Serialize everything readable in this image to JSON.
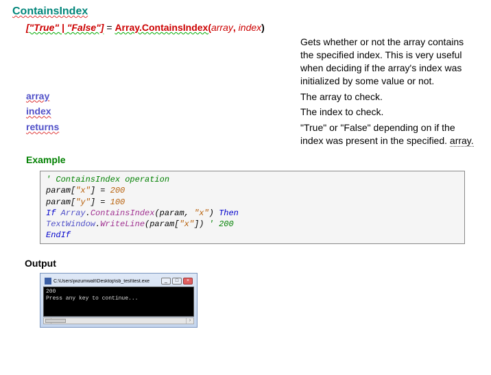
{
  "title": "ContainsIndex",
  "signature": {
    "return_spec": "[\"True\" | \"False\"]",
    "equals": " =  ",
    "class_method": "Array.ContainsIndex(",
    "arg1": "array",
    "sep": ",  ",
    "arg2": "index",
    "close": ")"
  },
  "description": "Gets whether or not the array contains the specified index. This is very useful when deciding if the array's index was initialized by some value or not.",
  "params": [
    {
      "name": "array",
      "desc": "The array to check."
    },
    {
      "name": "index",
      "desc": "The index to check."
    },
    {
      "name": "returns",
      "desc": "\"True\" or \"False\" depending on if the index was present in the specified. ",
      "desc_tail": "array."
    }
  ],
  "example_label": "Example",
  "code": {
    "l1": "' ContainsIndex operation",
    "l2a": "param[",
    "l2b": "\"x\"",
    "l2c": "] = ",
    "l2d": "200",
    "l3a": "param[",
    "l3b": "\"y\"",
    "l3c": "] = ",
    "l3d": "100",
    "l4a": "If ",
    "l4b": "Array",
    "l4c": ".",
    "l4d": "ContainsIndex",
    "l4e": "(param, ",
    "l4f": "\"x\"",
    "l4g": ") ",
    "l4h": "Then",
    "l5a": " TextWindow",
    "l5b": ".",
    "l5c": "WriteLine",
    "l5d": "(param[",
    "l5e": "\"x\"",
    "l5f": "]) ",
    "l5g": "' 200",
    "l6": "EndIf"
  },
  "output_label": "Output",
  "console": {
    "title_path": "C:\\Users\\jwzumwalt\\Desktop\\sb_test\\test.exe",
    "line1": "200",
    "line2": "Press any key to continue..."
  }
}
